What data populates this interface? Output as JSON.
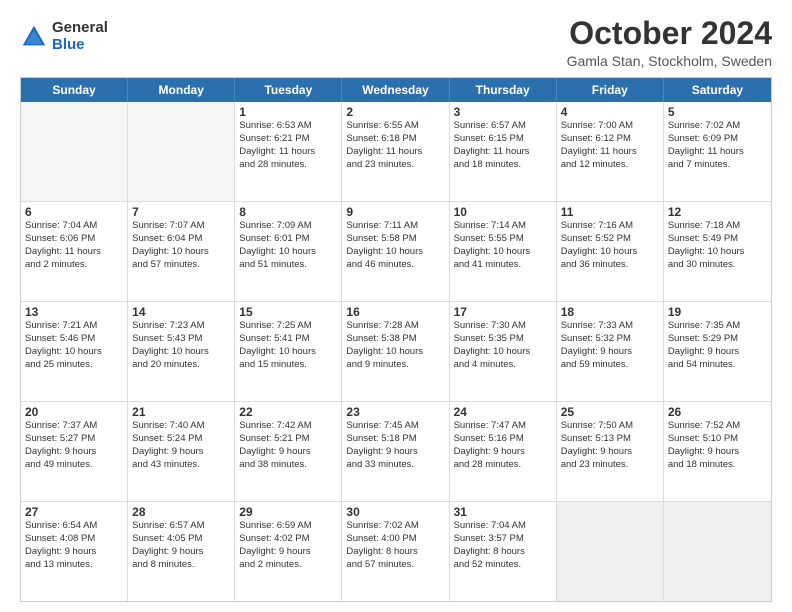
{
  "logo": {
    "general": "General",
    "blue": "Blue"
  },
  "title": "October 2024",
  "subtitle": "Gamla Stan, Stockholm, Sweden",
  "header_days": [
    "Sunday",
    "Monday",
    "Tuesday",
    "Wednesday",
    "Thursday",
    "Friday",
    "Saturday"
  ],
  "weeks": [
    [
      {
        "day": "",
        "info": [],
        "empty": true
      },
      {
        "day": "",
        "info": [],
        "empty": true
      },
      {
        "day": "1",
        "info": [
          "Sunrise: 6:53 AM",
          "Sunset: 6:21 PM",
          "Daylight: 11 hours",
          "and 28 minutes."
        ]
      },
      {
        "day": "2",
        "info": [
          "Sunrise: 6:55 AM",
          "Sunset: 6:18 PM",
          "Daylight: 11 hours",
          "and 23 minutes."
        ]
      },
      {
        "day": "3",
        "info": [
          "Sunrise: 6:57 AM",
          "Sunset: 6:15 PM",
          "Daylight: 11 hours",
          "and 18 minutes."
        ]
      },
      {
        "day": "4",
        "info": [
          "Sunrise: 7:00 AM",
          "Sunset: 6:12 PM",
          "Daylight: 11 hours",
          "and 12 minutes."
        ]
      },
      {
        "day": "5",
        "info": [
          "Sunrise: 7:02 AM",
          "Sunset: 6:09 PM",
          "Daylight: 11 hours",
          "and 7 minutes."
        ]
      }
    ],
    [
      {
        "day": "6",
        "info": [
          "Sunrise: 7:04 AM",
          "Sunset: 6:06 PM",
          "Daylight: 11 hours",
          "and 2 minutes."
        ]
      },
      {
        "day": "7",
        "info": [
          "Sunrise: 7:07 AM",
          "Sunset: 6:04 PM",
          "Daylight: 10 hours",
          "and 57 minutes."
        ]
      },
      {
        "day": "8",
        "info": [
          "Sunrise: 7:09 AM",
          "Sunset: 6:01 PM",
          "Daylight: 10 hours",
          "and 51 minutes."
        ]
      },
      {
        "day": "9",
        "info": [
          "Sunrise: 7:11 AM",
          "Sunset: 5:58 PM",
          "Daylight: 10 hours",
          "and 46 minutes."
        ]
      },
      {
        "day": "10",
        "info": [
          "Sunrise: 7:14 AM",
          "Sunset: 5:55 PM",
          "Daylight: 10 hours",
          "and 41 minutes."
        ]
      },
      {
        "day": "11",
        "info": [
          "Sunrise: 7:16 AM",
          "Sunset: 5:52 PM",
          "Daylight: 10 hours",
          "and 36 minutes."
        ]
      },
      {
        "day": "12",
        "info": [
          "Sunrise: 7:18 AM",
          "Sunset: 5:49 PM",
          "Daylight: 10 hours",
          "and 30 minutes."
        ]
      }
    ],
    [
      {
        "day": "13",
        "info": [
          "Sunrise: 7:21 AM",
          "Sunset: 5:46 PM",
          "Daylight: 10 hours",
          "and 25 minutes."
        ]
      },
      {
        "day": "14",
        "info": [
          "Sunrise: 7:23 AM",
          "Sunset: 5:43 PM",
          "Daylight: 10 hours",
          "and 20 minutes."
        ]
      },
      {
        "day": "15",
        "info": [
          "Sunrise: 7:25 AM",
          "Sunset: 5:41 PM",
          "Daylight: 10 hours",
          "and 15 minutes."
        ]
      },
      {
        "day": "16",
        "info": [
          "Sunrise: 7:28 AM",
          "Sunset: 5:38 PM",
          "Daylight: 10 hours",
          "and 9 minutes."
        ]
      },
      {
        "day": "17",
        "info": [
          "Sunrise: 7:30 AM",
          "Sunset: 5:35 PM",
          "Daylight: 10 hours",
          "and 4 minutes."
        ]
      },
      {
        "day": "18",
        "info": [
          "Sunrise: 7:33 AM",
          "Sunset: 5:32 PM",
          "Daylight: 9 hours",
          "and 59 minutes."
        ]
      },
      {
        "day": "19",
        "info": [
          "Sunrise: 7:35 AM",
          "Sunset: 5:29 PM",
          "Daylight: 9 hours",
          "and 54 minutes."
        ]
      }
    ],
    [
      {
        "day": "20",
        "info": [
          "Sunrise: 7:37 AM",
          "Sunset: 5:27 PM",
          "Daylight: 9 hours",
          "and 49 minutes."
        ]
      },
      {
        "day": "21",
        "info": [
          "Sunrise: 7:40 AM",
          "Sunset: 5:24 PM",
          "Daylight: 9 hours",
          "and 43 minutes."
        ]
      },
      {
        "day": "22",
        "info": [
          "Sunrise: 7:42 AM",
          "Sunset: 5:21 PM",
          "Daylight: 9 hours",
          "and 38 minutes."
        ]
      },
      {
        "day": "23",
        "info": [
          "Sunrise: 7:45 AM",
          "Sunset: 5:18 PM",
          "Daylight: 9 hours",
          "and 33 minutes."
        ]
      },
      {
        "day": "24",
        "info": [
          "Sunrise: 7:47 AM",
          "Sunset: 5:16 PM",
          "Daylight: 9 hours",
          "and 28 minutes."
        ]
      },
      {
        "day": "25",
        "info": [
          "Sunrise: 7:50 AM",
          "Sunset: 5:13 PM",
          "Daylight: 9 hours",
          "and 23 minutes."
        ]
      },
      {
        "day": "26",
        "info": [
          "Sunrise: 7:52 AM",
          "Sunset: 5:10 PM",
          "Daylight: 9 hours",
          "and 18 minutes."
        ]
      }
    ],
    [
      {
        "day": "27",
        "info": [
          "Sunrise: 6:54 AM",
          "Sunset: 4:08 PM",
          "Daylight: 9 hours",
          "and 13 minutes."
        ]
      },
      {
        "day": "28",
        "info": [
          "Sunrise: 6:57 AM",
          "Sunset: 4:05 PM",
          "Daylight: 9 hours",
          "and 8 minutes."
        ]
      },
      {
        "day": "29",
        "info": [
          "Sunrise: 6:59 AM",
          "Sunset: 4:02 PM",
          "Daylight: 9 hours",
          "and 2 minutes."
        ]
      },
      {
        "day": "30",
        "info": [
          "Sunrise: 7:02 AM",
          "Sunset: 4:00 PM",
          "Daylight: 8 hours",
          "and 57 minutes."
        ]
      },
      {
        "day": "31",
        "info": [
          "Sunrise: 7:04 AM",
          "Sunset: 3:57 PM",
          "Daylight: 8 hours",
          "and 52 minutes."
        ]
      },
      {
        "day": "",
        "info": [],
        "empty": true,
        "shaded": true
      },
      {
        "day": "",
        "info": [],
        "empty": true,
        "shaded": true
      }
    ]
  ]
}
